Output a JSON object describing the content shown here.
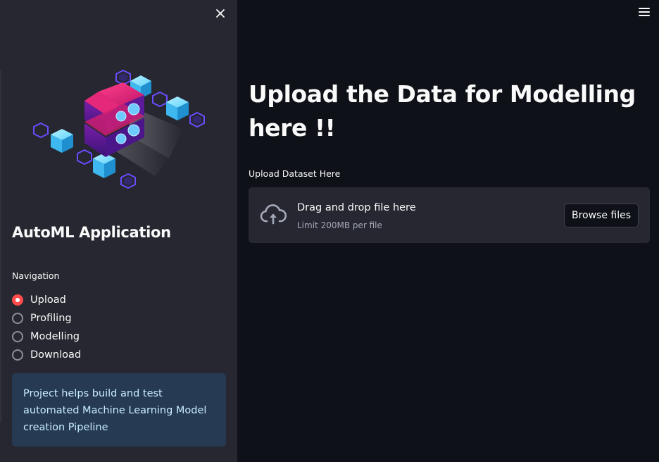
{
  "sidebar": {
    "title": "AutoML Application",
    "navigation_label": "Navigation",
    "nav_items": [
      {
        "label": "Upload",
        "selected": true
      },
      {
        "label": "Profiling",
        "selected": false
      },
      {
        "label": "Modelling",
        "selected": false
      },
      {
        "label": "Download",
        "selected": false
      }
    ],
    "info_text": "Project helps build and test automated Machine Learning Model creation Pipeline",
    "close_icon": "close-icon",
    "illustration": "isometric-servers-and-cubes-illustration"
  },
  "header": {
    "menu_icon": "hamburger-menu-icon"
  },
  "main": {
    "title": "Upload the Data for Modelling here !!",
    "uploader": {
      "label": "Upload Dataset Here",
      "drop_text": "Drag and drop file here",
      "limit_text": "Limit 200MB per file",
      "browse_label": "Browse files",
      "icon": "cloud-upload-icon"
    }
  },
  "colors": {
    "background": "#0e1117",
    "sidebar": "#262730",
    "accent": "#ff4b4b",
    "info_bg": "#263b53",
    "info_text": "#c7ebff"
  }
}
